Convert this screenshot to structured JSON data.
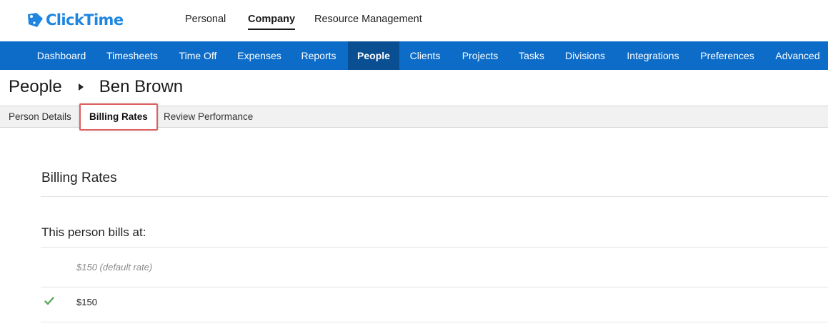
{
  "app": {
    "logo_text": "ClickTime",
    "brand_color": "#1e86e0",
    "nav_color": "#0d6cc8",
    "nav_active_color": "#0a4f91"
  },
  "topnav": {
    "items": [
      {
        "label": "Personal",
        "active": false
      },
      {
        "label": "Company",
        "active": true
      },
      {
        "label": "Resource Management",
        "active": false
      }
    ]
  },
  "mainnav": {
    "items": [
      {
        "label": "Dashboard",
        "active": false
      },
      {
        "label": "Timesheets",
        "active": false
      },
      {
        "label": "Time Off",
        "active": false
      },
      {
        "label": "Expenses",
        "active": false
      },
      {
        "label": "Reports",
        "active": false
      },
      {
        "label": "People",
        "active": true
      },
      {
        "label": "Clients",
        "active": false
      },
      {
        "label": "Projects",
        "active": false
      },
      {
        "label": "Tasks",
        "active": false
      },
      {
        "label": "Divisions",
        "active": false
      },
      {
        "label": "Integrations",
        "active": false
      },
      {
        "label": "Preferences",
        "active": false
      },
      {
        "label": "Advanced",
        "active": false
      }
    ]
  },
  "breadcrumb": {
    "parent": "People",
    "current": "Ben Brown"
  },
  "subtabs": {
    "items": [
      {
        "label": "Person Details",
        "active": false
      },
      {
        "label": "Billing Rates",
        "active": true
      },
      {
        "label": "Review Performance",
        "active": false
      }
    ]
  },
  "content": {
    "section_title": "Billing Rates",
    "bills_at_label": "This person bills at:",
    "rates": [
      {
        "label": "$150 (default rate)",
        "selected": false
      },
      {
        "label": "$150",
        "selected": true
      }
    ],
    "check_color": "#5aa85a"
  }
}
